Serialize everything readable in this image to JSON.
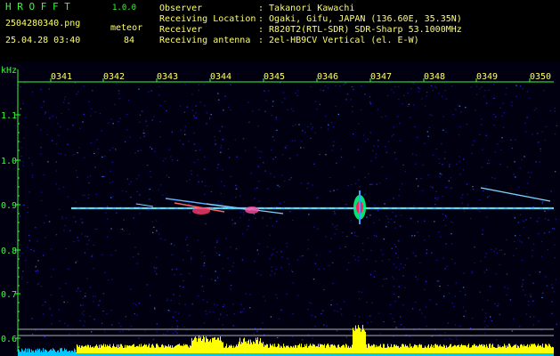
{
  "header": {
    "logo": "H R O F F T",
    "version": "1.0.0",
    "filename": "2504280340.png",
    "mode": "meteor",
    "datetime": "25.04.28 03:40",
    "count": "84",
    "labels": {
      "observer": "Observer",
      "location": "Receiving Location",
      "receiver": "Receiver",
      "antenna": "Receiving antenna"
    },
    "values": {
      "observer": ": Takanori Kawachi",
      "location": ": Ogaki, Gifu, JAPAN (136.60E, 35.35N)",
      "receiver": ": R820T2(RTL-SDR) SDR-Sharp 53.1000MHz",
      "antenna": ": 2el-HB9CV Vertical (el. E-W)"
    }
  },
  "axis": {
    "y_unit": "kHz",
    "y_ticks": [
      "1.1",
      "1.0",
      "0.9",
      "0.8",
      "0.7",
      "0.6"
    ],
    "time_ticks": [
      "0341",
      "0342",
      "0343",
      "0344",
      "0345",
      "0346",
      "0347",
      "0348",
      "0349",
      "0350"
    ]
  },
  "colors": {
    "background": "#000000",
    "noise": "#1a1aa0",
    "carrier": "#40c0ff",
    "histogram": "#ffff00",
    "baseline": "#00c8ff",
    "text_green": "#33ff33",
    "text_yellow": "#ffff66"
  }
}
